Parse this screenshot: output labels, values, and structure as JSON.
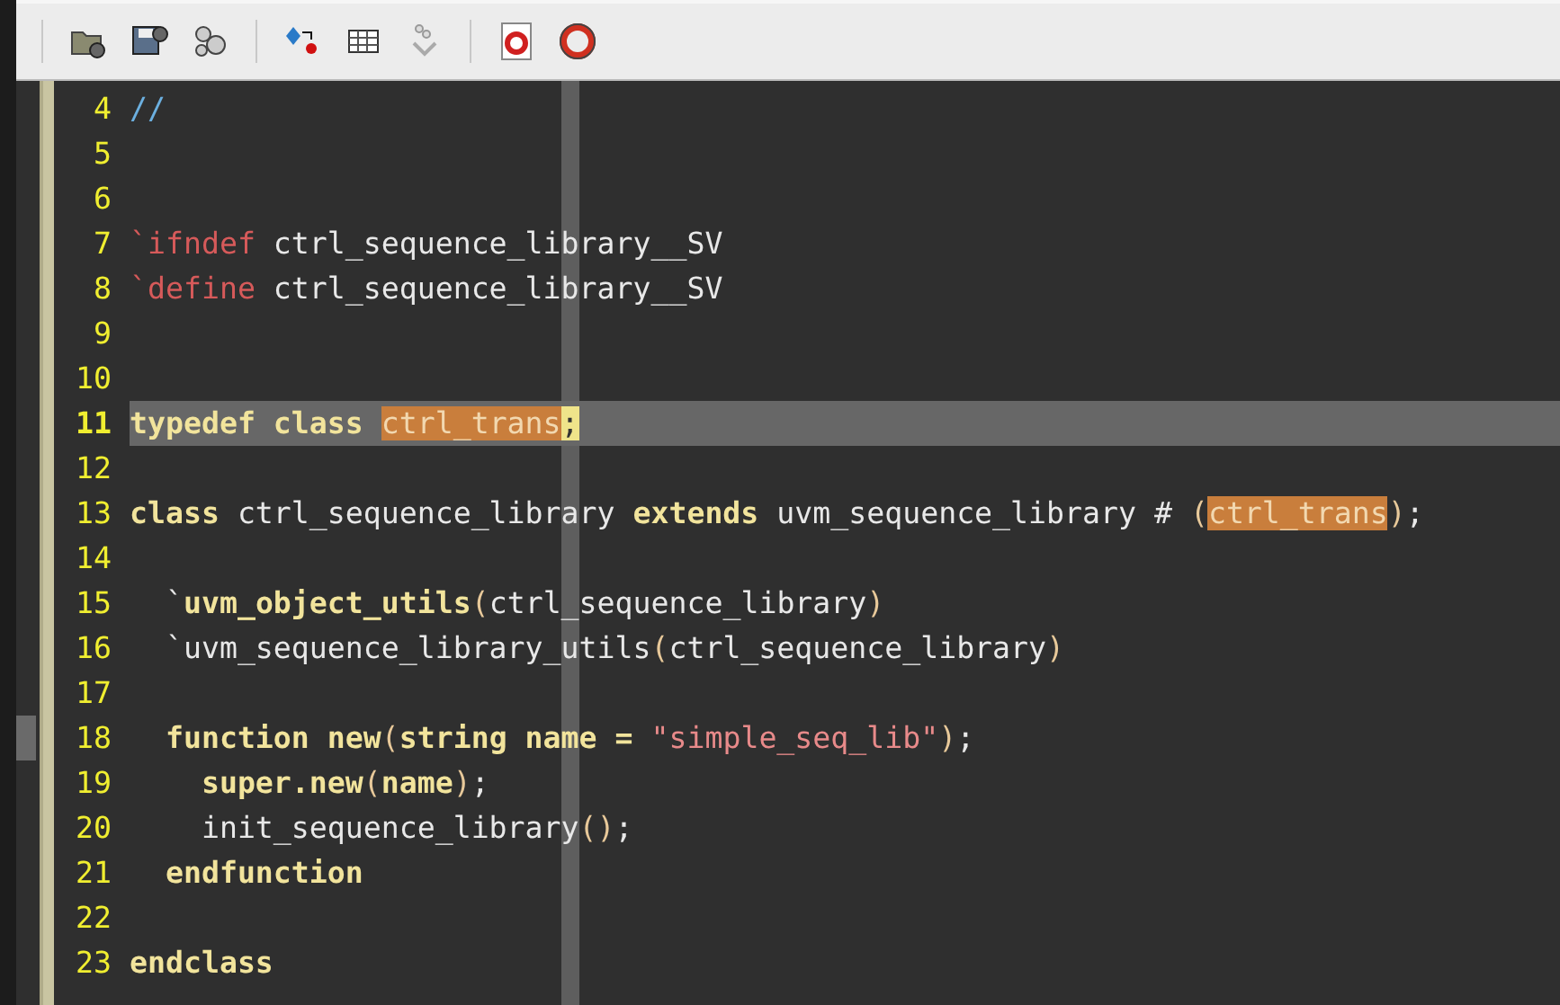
{
  "editor": {
    "lines": [
      {
        "number": "4",
        "marked": false,
        "current": false,
        "tokens": [
          {
            "kind": "comment",
            "text": "//"
          }
        ]
      },
      {
        "number": "5",
        "marked": false,
        "current": false
      },
      {
        "number": "6",
        "marked": false,
        "current": false
      },
      {
        "number": "7",
        "marked": false,
        "current": false,
        "tokens": [
          {
            "kind": "directive",
            "text": "`ifndef"
          },
          {
            "kind": "plain",
            "text": " ctrl_sequence_library__SV"
          }
        ]
      },
      {
        "number": "8",
        "marked": false,
        "current": false,
        "tokens": [
          {
            "kind": "directive",
            "text": "`define"
          },
          {
            "kind": "plain",
            "text": " ctrl_sequence_library__SV"
          }
        ]
      },
      {
        "number": "9",
        "marked": false,
        "current": false
      },
      {
        "number": "10",
        "marked": false,
        "current": false
      },
      {
        "number": "11",
        "marked": false,
        "current": true,
        "tokens": [
          {
            "kind": "keyword",
            "text": "typedef class "
          },
          {
            "kind": "match",
            "text": "ctrl_trans"
          },
          {
            "kind": "cursor",
            "text": ";"
          }
        ]
      },
      {
        "number": "12",
        "marked": false,
        "current": false
      },
      {
        "number": "13",
        "marked": false,
        "current": false,
        "tokens": [
          {
            "kind": "keyword",
            "text": "class"
          },
          {
            "kind": "plain",
            "text": " ctrl_sequence_library "
          },
          {
            "kind": "keyword",
            "text": "extends"
          },
          {
            "kind": "plain",
            "text": " uvm_sequence_library # "
          },
          {
            "kind": "paren",
            "text": "("
          },
          {
            "kind": "match",
            "text": "ctrl_trans"
          },
          {
            "kind": "paren",
            "text": ")"
          },
          {
            "kind": "plain",
            "text": ";"
          }
        ]
      },
      {
        "number": "14",
        "marked": false,
        "current": false
      },
      {
        "number": "15",
        "marked": false,
        "current": false,
        "tokens": [
          {
            "kind": "plain",
            "text": "  `"
          },
          {
            "kind": "keyword",
            "text": "uvm_object_utils"
          },
          {
            "kind": "paren",
            "text": "("
          },
          {
            "kind": "plain",
            "text": "ctrl_sequence_library"
          },
          {
            "kind": "paren",
            "text": ")"
          }
        ]
      },
      {
        "number": "16",
        "marked": false,
        "current": false,
        "tokens": [
          {
            "kind": "plain",
            "text": "  `uvm_sequence_library_utils"
          },
          {
            "kind": "paren",
            "text": "("
          },
          {
            "kind": "plain",
            "text": "ctrl_sequence_library"
          },
          {
            "kind": "paren",
            "text": ")"
          }
        ]
      },
      {
        "number": "17",
        "marked": false,
        "current": false
      },
      {
        "number": "18",
        "marked": true,
        "current": false,
        "tokens": [
          {
            "kind": "keyword",
            "text": "  function new"
          },
          {
            "kind": "paren",
            "text": "("
          },
          {
            "kind": "keyword",
            "text": "string name = "
          },
          {
            "kind": "string",
            "text": "\"simple_seq_lib\""
          },
          {
            "kind": "paren",
            "text": ")"
          },
          {
            "kind": "plain",
            "text": ";"
          }
        ]
      },
      {
        "number": "19",
        "marked": false,
        "current": false,
        "tokens": [
          {
            "kind": "keyword",
            "text": "    super.new"
          },
          {
            "kind": "paren",
            "text": "("
          },
          {
            "kind": "keyword",
            "text": "name"
          },
          {
            "kind": "paren",
            "text": ")"
          },
          {
            "kind": "plain",
            "text": ";"
          }
        ]
      },
      {
        "number": "20",
        "marked": false,
        "current": false,
        "tokens": [
          {
            "kind": "plain",
            "text": "    init_sequence_library"
          },
          {
            "kind": "paren",
            "text": "()"
          },
          {
            "kind": "plain",
            "text": ";"
          }
        ]
      },
      {
        "number": "21",
        "marked": false,
        "current": false,
        "tokens": [
          {
            "kind": "keyword",
            "text": "  endfunction"
          }
        ]
      },
      {
        "number": "22",
        "marked": false,
        "current": false
      },
      {
        "number": "23",
        "marked": false,
        "current": false,
        "tokens": [
          {
            "kind": "keyword",
            "text": "endclass"
          }
        ]
      }
    ]
  }
}
